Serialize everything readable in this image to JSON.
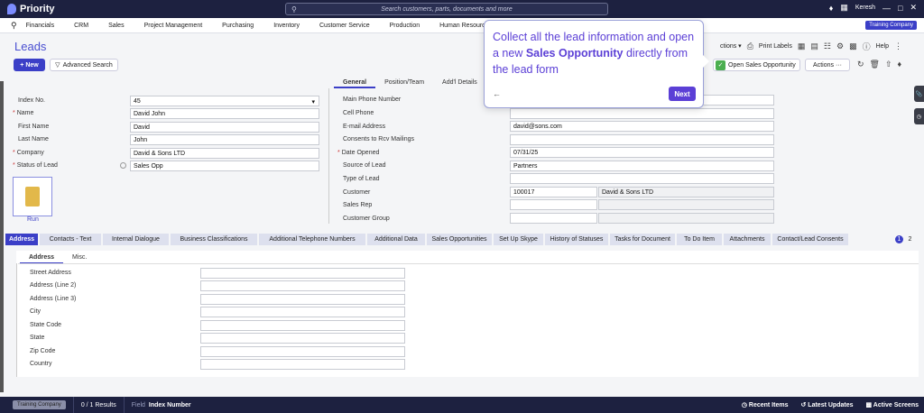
{
  "topbar": {
    "brand": "Priority",
    "search_placeholder": "Search customers, parts, documents and more",
    "user": "Keresh"
  },
  "menu": {
    "items": [
      "Financials",
      "CRM",
      "Sales",
      "Project Management",
      "Purchasing",
      "Inventory",
      "Customer Service",
      "Production",
      "Human Resources"
    ],
    "company_badge": "Training Company"
  },
  "page": {
    "title": "Leads",
    "new_label": "+ New",
    "advanced_search_label": "Advanced Search",
    "actions_dropdown_label": "ctions",
    "print_labels": "Print Labels",
    "help_label": "Help",
    "open_sales_opportunity": "Open Sales Opportunity",
    "actions_label": "Actions ···"
  },
  "form_left": [
    {
      "label": "Index No.",
      "value": "45",
      "required": false
    },
    {
      "label": "Name",
      "value": "David John",
      "required": true
    },
    {
      "label": "First Name",
      "value": "David",
      "required": false
    },
    {
      "label": "Last Name",
      "value": "John",
      "required": false
    },
    {
      "label": "Company",
      "value": "David & Sons LTD",
      "required": true
    },
    {
      "label": "Status of Lead",
      "value": "Sales Opp",
      "required": true
    }
  ],
  "run_label": "Run",
  "right_tabs": [
    "General",
    "Position/Team",
    "Add'l Details"
  ],
  "form_right": [
    {
      "label": "Main Phone Number",
      "value": "",
      "required": false
    },
    {
      "label": "Cell Phone",
      "value": "",
      "required": false
    },
    {
      "label": "E-mail Address",
      "value": "david@sons.com",
      "required": false
    },
    {
      "label": "Consents to Rcv Mailings",
      "value": "",
      "required": false
    },
    {
      "label": "Date Opened",
      "value": "07/31/25",
      "required": true
    },
    {
      "label": "Source of Lead",
      "value": "Partners",
      "required": false
    },
    {
      "label": "Type of Lead",
      "value": "",
      "required": false
    },
    {
      "label": "Customer",
      "value": "100017",
      "value2": "David & Sons LTD",
      "required": false
    },
    {
      "label": "Sales Rep",
      "value": "",
      "required": false
    },
    {
      "label": "Customer Group",
      "value": "",
      "required": false
    }
  ],
  "bottom_tabs": [
    "Address",
    "Contacts - Text",
    "Internal Dialogue",
    "Business Classifications",
    "Additional Telephone Numbers",
    "Additional Data",
    "Sales Opportunities",
    "Set Up Skype",
    "History of Statuses",
    "Tasks for Document",
    "To Do Item",
    "Attachments",
    "Contact/Lead Consents"
  ],
  "pager": [
    "1",
    "2"
  ],
  "sub_tabs": [
    "Address",
    "Misc."
  ],
  "address_fields": [
    "Street Address",
    "Address (Line 2)",
    "Address (Line 3)",
    "City",
    "State Code",
    "State",
    "Zip Code",
    "Country"
  ],
  "tooltip": {
    "text_before": "Collect all the lead information and open a new ",
    "text_bold": "Sales Opportunity",
    "text_after": " directly from the lead form",
    "back": "←",
    "next": "Next"
  },
  "statusbar": {
    "company": "Training Company",
    "results": "0 / 1 Results",
    "field_label": "Field",
    "field_value": "Index Number",
    "recent_items": "Recent Items",
    "latest_updates": "Latest Updates",
    "active_screens": "Active Screens"
  }
}
